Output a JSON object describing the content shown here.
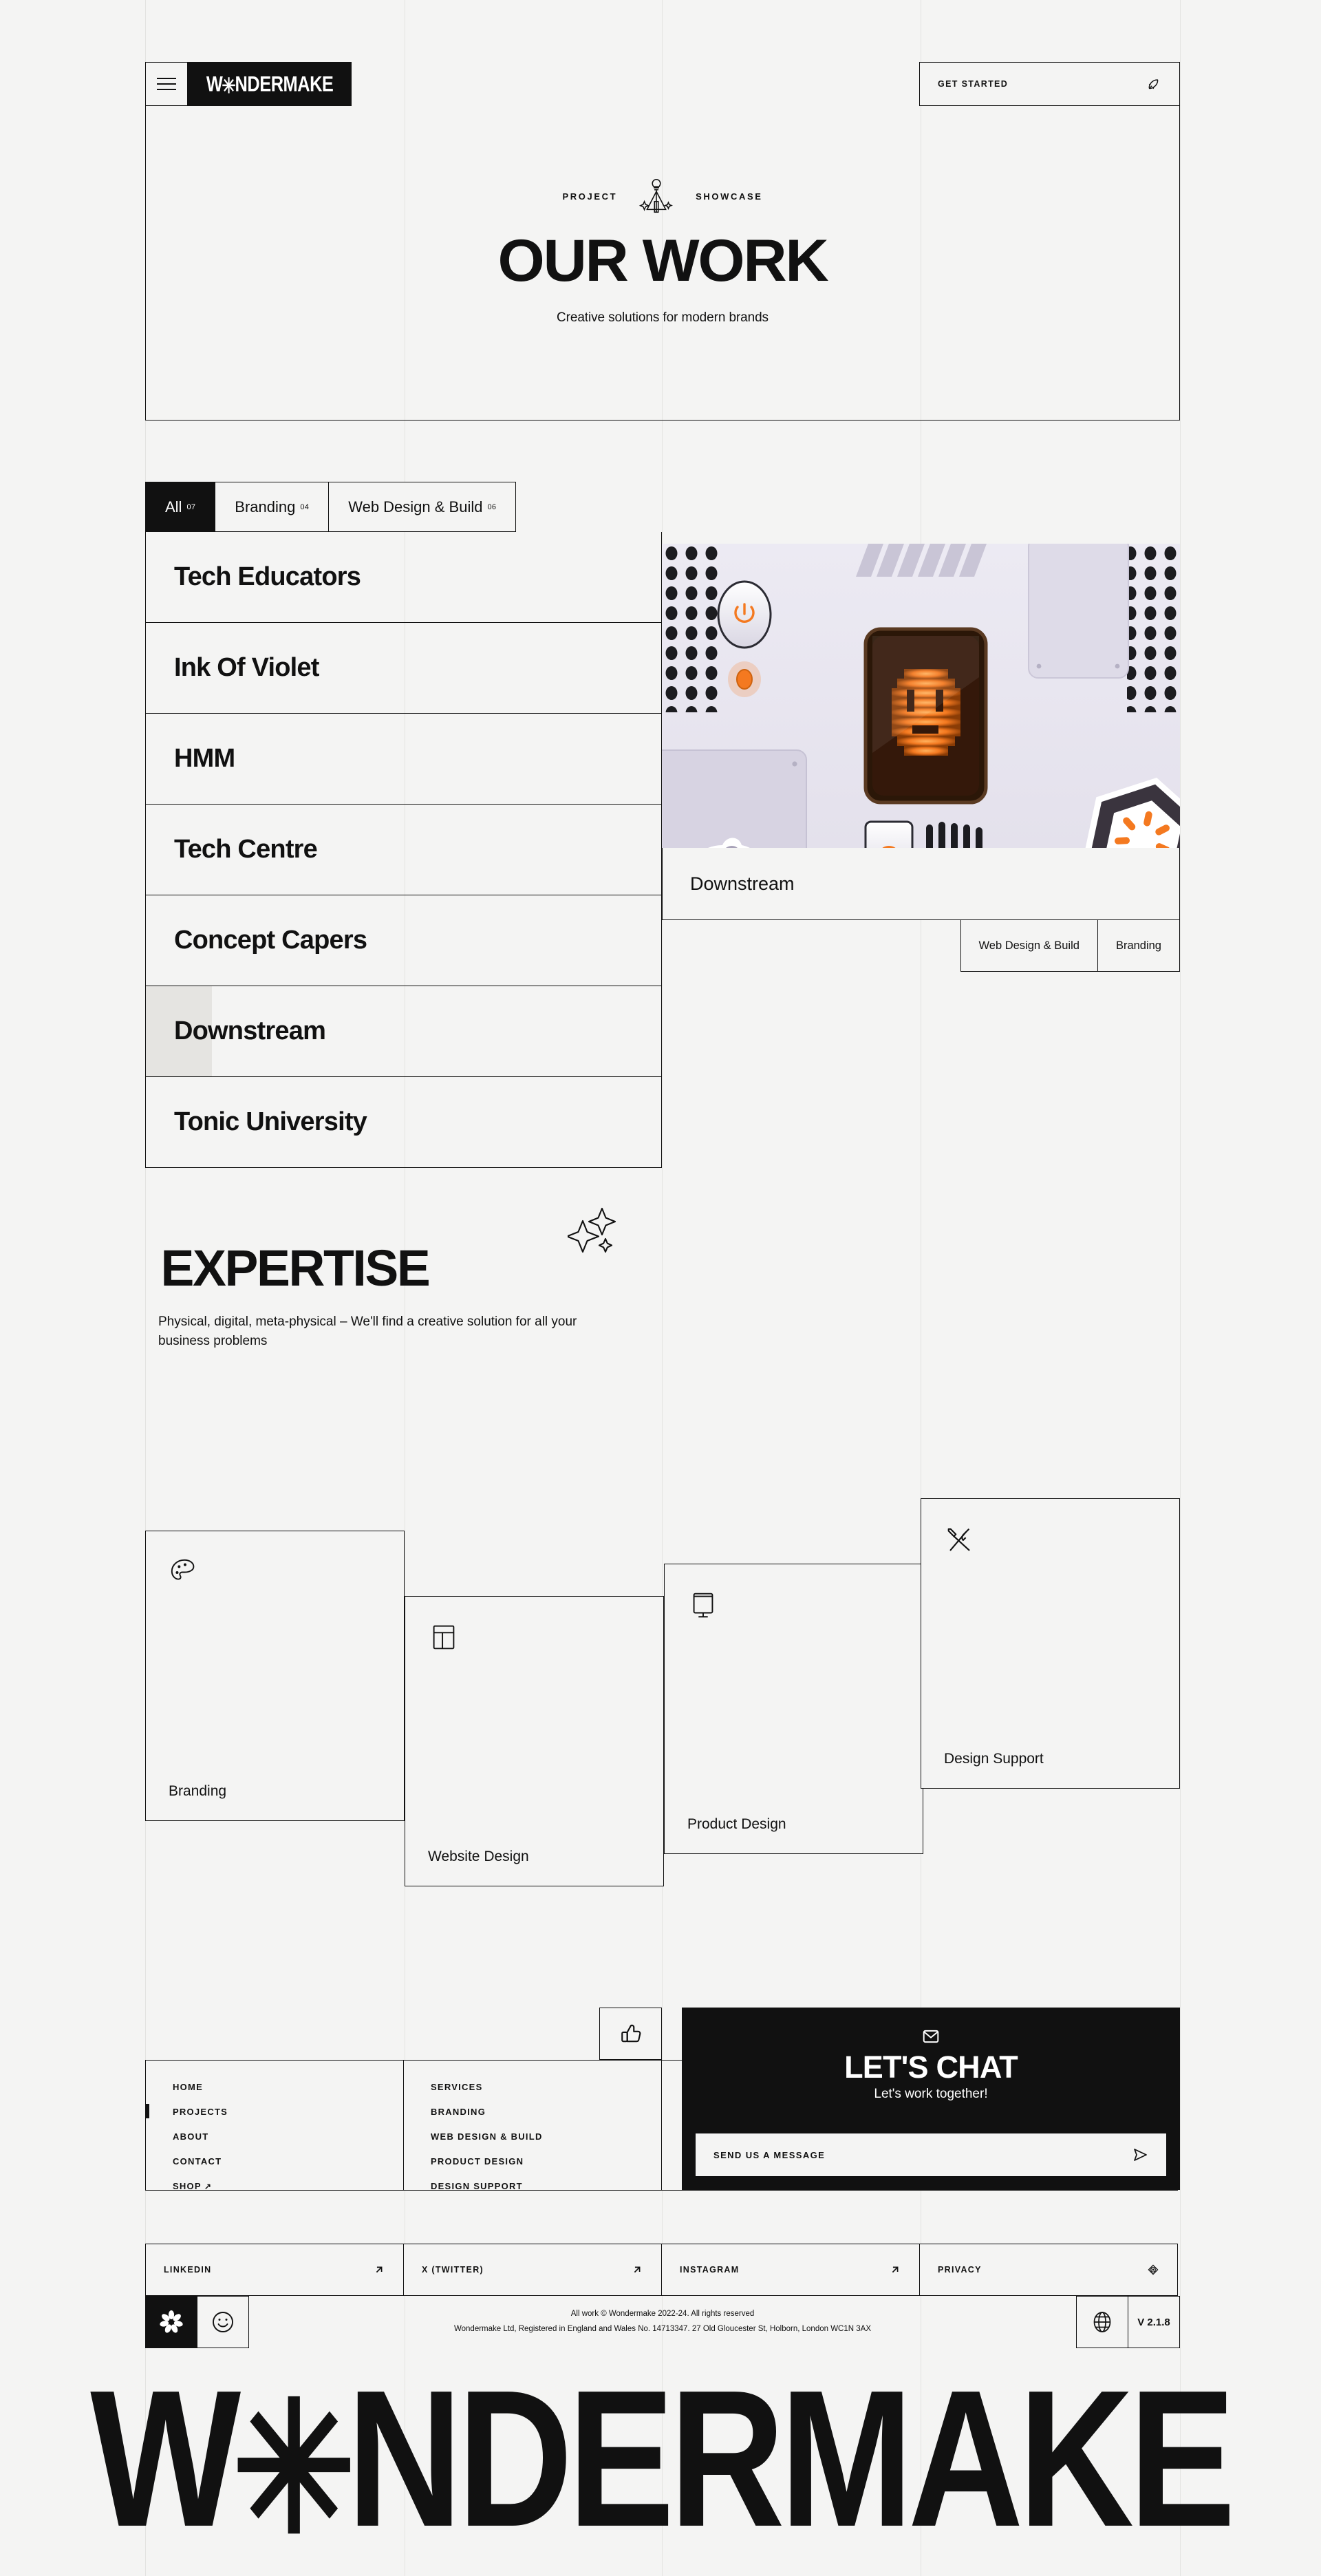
{
  "brand": {
    "name_before": "W",
    "name_asterisk": "✳",
    "name_after": "NDERMAKE",
    "full": "WONDERMAKE"
  },
  "header": {
    "menu_icon": "hamburger-icon",
    "get_started_label": "GET STARTED",
    "get_started_icon": "rocket-icon"
  },
  "hero": {
    "eyebrow_left": "PROJECT",
    "eyebrow_right": "SHOWCASE",
    "eyebrow_icon": "lightbulb-sparkle-icon",
    "title": "OUR WORK",
    "subtitle": "Creative solutions for modern brands"
  },
  "filters": [
    {
      "label": "All",
      "count": "07",
      "active": true
    },
    {
      "label": "Branding",
      "count": "04",
      "active": false
    },
    {
      "label": "Web Design & Build",
      "count": "06",
      "active": false
    }
  ],
  "projects": [
    {
      "name": "Tech Educators",
      "hovered": false
    },
    {
      "name": "Ink Of Violet",
      "hovered": false
    },
    {
      "name": "HMM",
      "hovered": false
    },
    {
      "name": "Tech Centre",
      "hovered": false
    },
    {
      "name": "Concept Capers",
      "hovered": false
    },
    {
      "name": "Downstream",
      "hovered": true
    },
    {
      "name": "Tonic University",
      "hovered": false
    }
  ],
  "preview": {
    "title": "Downstream",
    "image_alt": "machine-panel-illustration",
    "tags": [
      "Web Design & Build",
      "Branding"
    ],
    "accent": "#f47920"
  },
  "expertise": {
    "title": "EXPERTISE",
    "sparkle_icon": "sparkles-icon",
    "subtitle": "Physical, digital, meta-physical – We'll find a creative solution for all your business problems",
    "cards": [
      {
        "label": "Branding",
        "icon": "palette-icon"
      },
      {
        "label": "Website Design",
        "icon": "layout-icon"
      },
      {
        "label": "Product Design",
        "icon": "monitor-icon"
      },
      {
        "label": "Design Support",
        "icon": "tools-icon"
      }
    ]
  },
  "thumbs": {
    "icon": "thumbs-up-icon"
  },
  "chat": {
    "mail_icon": "envelope-icon",
    "title": "LET'S CHAT",
    "subtitle": "Let's work together!",
    "input_label": "SEND US A MESSAGE",
    "send_icon": "send-icon"
  },
  "footer_nav": {
    "col1": [
      {
        "label": "HOME",
        "active": false,
        "external": false
      },
      {
        "label": "PROJECTS",
        "active": true,
        "external": false
      },
      {
        "label": "ABOUT",
        "active": false,
        "external": false
      },
      {
        "label": "CONTACT",
        "active": false,
        "external": false
      },
      {
        "label": "SHOP",
        "active": false,
        "external": true
      }
    ],
    "col2": [
      {
        "label": "SERVICES",
        "active": false,
        "external": false
      },
      {
        "label": "BRANDING",
        "active": false,
        "external": false
      },
      {
        "label": "WEB DESIGN & BUILD",
        "active": false,
        "external": false
      },
      {
        "label": "PRODUCT DESIGN",
        "active": false,
        "external": false
      },
      {
        "label": "DESIGN SUPPORT",
        "active": false,
        "external": false
      }
    ]
  },
  "social": [
    {
      "label": "LINKEDIN",
      "icon": "arrow-up-right-icon"
    },
    {
      "label": "X (TWITTER)",
      "icon": "arrow-up-right-icon"
    },
    {
      "label": "INSTAGRAM",
      "icon": "arrow-up-right-icon"
    },
    {
      "label": "PRIVACY",
      "icon": "eye-icon"
    }
  ],
  "legal": {
    "asterisk_icon": "asterisk-icon",
    "smile_icon": "smiley-icon",
    "line1": "All work © Wondermake 2022-24. All rights reserved",
    "line2": "Wondermake Ltd, Registered in England and Wales No. 14713347. 27 Old Gloucester St, Holborn, London WC1N 3AX",
    "globe_icon": "globe-icon",
    "version": "V 2.1.8"
  }
}
